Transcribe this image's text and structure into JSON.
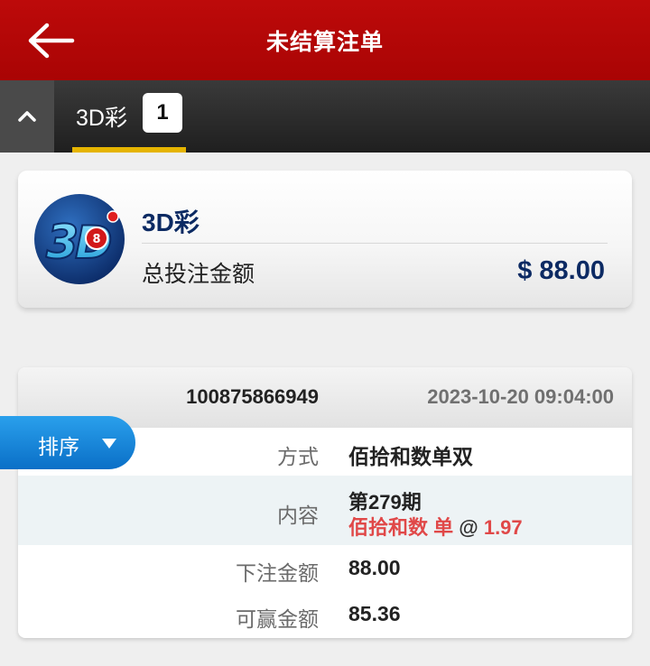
{
  "header": {
    "title": "未结算注单",
    "back_icon": "arrow-left-icon"
  },
  "tabs": [
    {
      "label": "3D彩",
      "count": "1",
      "active": true
    }
  ],
  "summary": {
    "game_name": "3D彩",
    "total_label": "总投注金额",
    "total_amount": "$ 88.00",
    "logo_text": "3D"
  },
  "bet": {
    "id": "100875866949",
    "time": "2023-10-20 09:04:00",
    "method_label": "方式",
    "method_value": "佰拾和数单双",
    "content_label": "内容",
    "period": "第279期",
    "selection": "佰拾和数 单",
    "at": "@",
    "odds": "1.97",
    "stake_label": "下注金额",
    "stake_value": "88.00",
    "win_label": "可赢金额",
    "win_value": "85.36"
  },
  "sort": {
    "label": "排序"
  },
  "colors": {
    "header_red": "#b00606",
    "navy": "#0c2a63",
    "accent_yellow": "#e5b400",
    "odds_red": "#e04848",
    "sort_blue": "#1787dc"
  }
}
